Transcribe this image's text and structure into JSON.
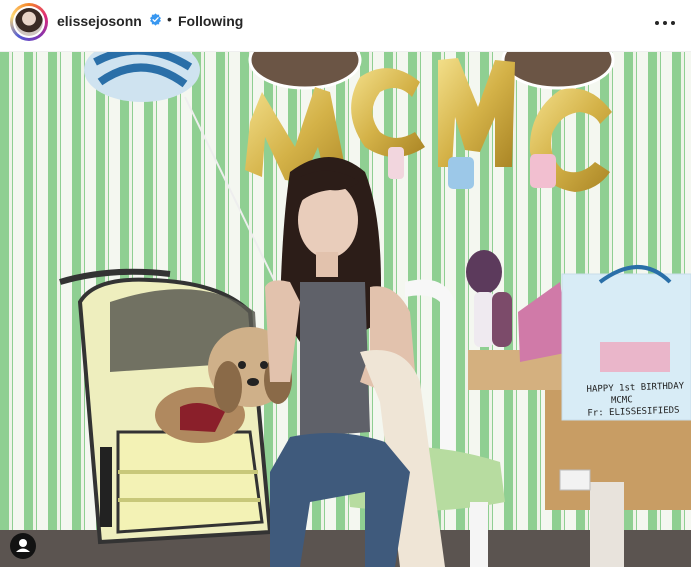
{
  "post": {
    "username": "elissejosonn",
    "separator": "•",
    "follow_status": "Following"
  },
  "photo": {
    "balloon_letters": [
      "M",
      "C",
      "M",
      "C"
    ],
    "bag_text_line1": "HAPPY 1st BIRTHDAY",
    "bag_text_line2": "MCMC",
    "bag_text_line3": "Fr: ELISSESIFIEDS"
  },
  "colors": {
    "stripe_green": "#8fcf92",
    "stripe_white": "#f4f7f0",
    "balloon_gold": "#d9b84a",
    "verified_blue": "#3897f0"
  },
  "icons": {
    "verified": "verified-badge-icon",
    "more": "more-options-icon",
    "user_tag": "user-tag-icon"
  }
}
